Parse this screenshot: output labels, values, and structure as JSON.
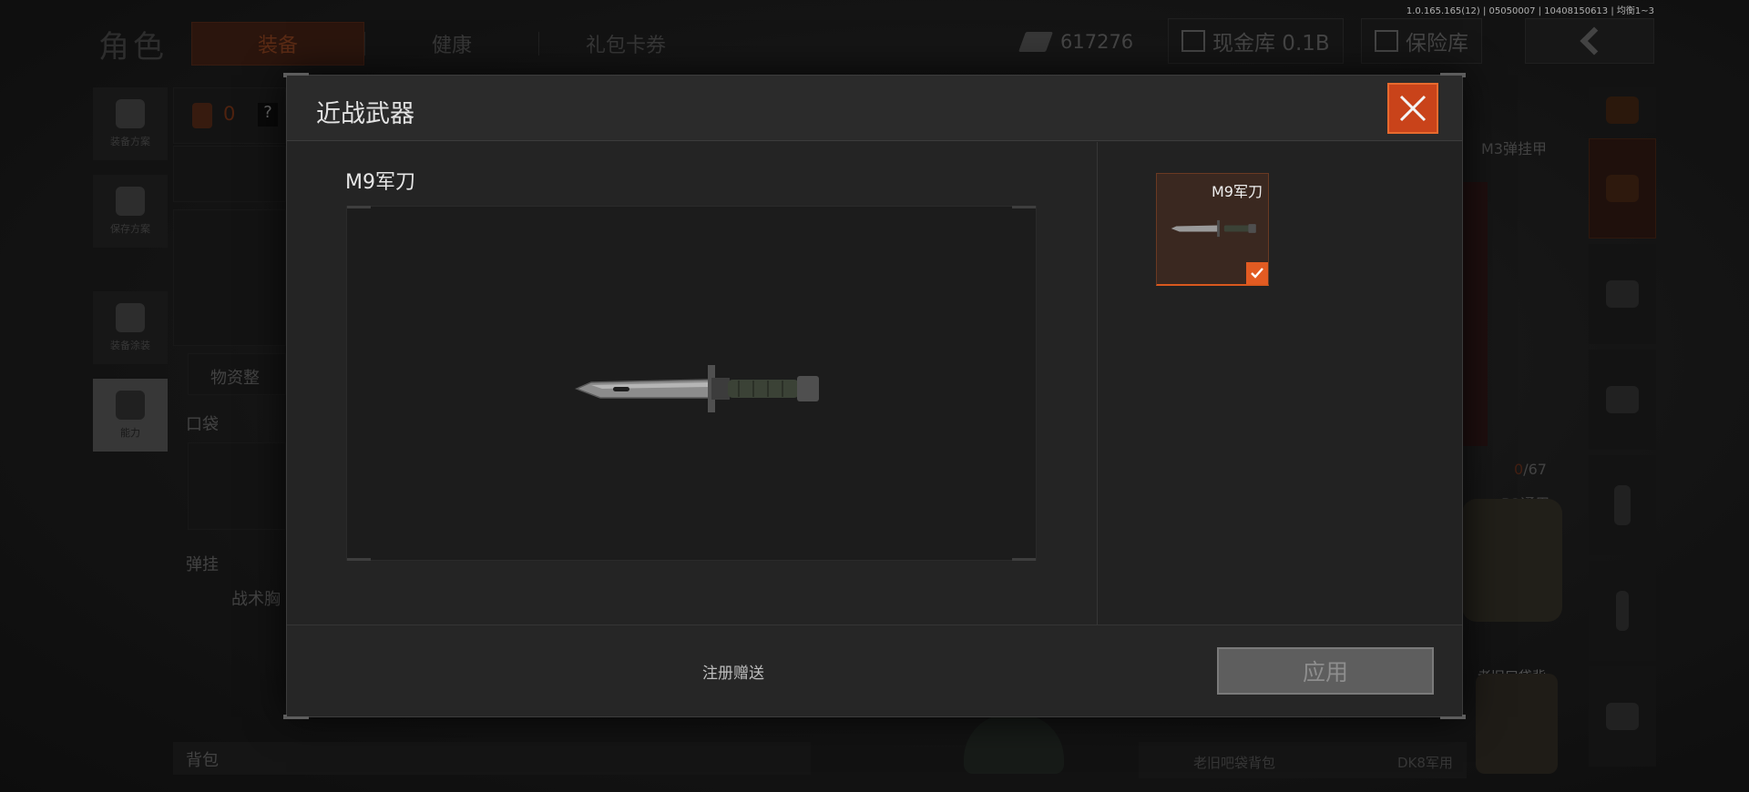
{
  "version_info": "1.0.165.165(12) | 05050007 | 10408150613 | 均衡1~3",
  "background": {
    "page_title": "角色",
    "tabs": [
      {
        "label": "装备",
        "active": true
      },
      {
        "label": "健康",
        "active": false
      },
      {
        "label": "礼包卡券",
        "active": false
      }
    ],
    "currency_amount": "617276",
    "cash_vault_label": "现金库 0.1B",
    "safe_vault_label": "保险库",
    "left_rail": [
      {
        "label": "装备方案",
        "icon": "vest-icon"
      },
      {
        "label": "保存方案",
        "icon": "download-icon"
      },
      {
        "label": "装备涂装",
        "icon": "soldier-icon"
      },
      {
        "label": "能力",
        "icon": "energy-hex-icon"
      }
    ],
    "armor_count": "0",
    "help_mark": "?",
    "supplies_label": "物资整",
    "pocket_label": "口袋",
    "rig_label": "弹挂",
    "tactical_label": "战术胸",
    "backpack_label": "背包",
    "armor_name": "M3弹挂甲",
    "capacity_used": "0",
    "capacity_total": "/67",
    "b3_label": "B3通用",
    "old_bag_label": "老旧口袋背",
    "old_bag_label2": "包",
    "old_pouch_label": "老旧吧袋背包",
    "dk8_label": "DK8军用",
    "accent_color": "#e25b22"
  },
  "modal": {
    "title": "近战武器",
    "selected_item_name": "M9军刀",
    "thumbnails": [
      {
        "name": "M9军刀",
        "selected": true
      }
    ],
    "footer_note": "注册赠送",
    "apply_label": "应用"
  }
}
